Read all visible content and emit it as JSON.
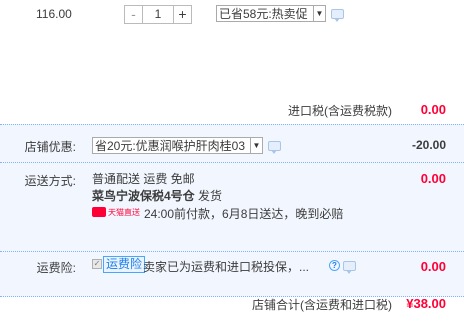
{
  "item": {
    "price": "116.00",
    "quantity": "1",
    "minus_label": "-",
    "plus_label": "+",
    "promo_selected": "已省58元:热卖促"
  },
  "import_tax": {
    "label": "进口税(含运费税款)",
    "value": "0.00"
  },
  "shop_discount": {
    "label": "店铺优惠:",
    "selected": "省20元:优惠润喉护肝肉桂03",
    "value": "-20.00"
  },
  "shipping": {
    "label": "运送方式:",
    "method": "普通配送 运费 免邮",
    "warehouse": "菜鸟宁波保税4号仓",
    "dispatch": "发货",
    "tmall_badge": "天猫直送",
    "time_text": "24:00前付款，6月8日送达，晚到必赔",
    "value": "0.00"
  },
  "insurance": {
    "label": "运费险:",
    "badge": "运费险",
    "text": "卖家已为运费和进口税投保，...",
    "info_icon": "?",
    "value": "0.00"
  },
  "total": {
    "label": "店铺合计(含运费和进口税)",
    "value": "¥38.00"
  },
  "colors": {
    "accent_red": "#ff0036",
    "panel_bg": "#f2f7ff",
    "border_blue": "#80b2ff"
  }
}
